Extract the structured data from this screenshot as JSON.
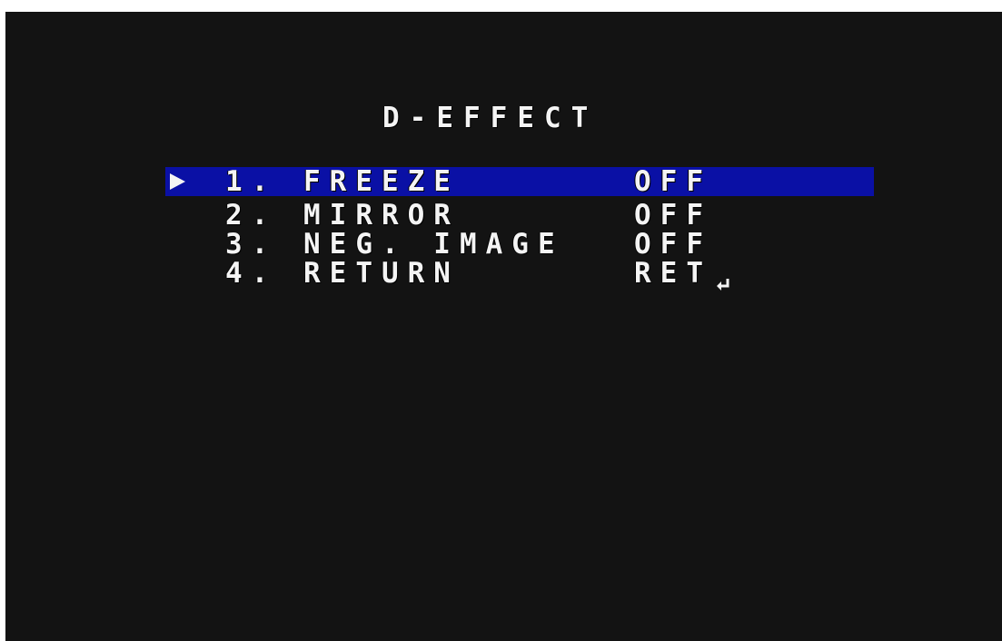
{
  "menu": {
    "title": "D-EFFECT",
    "items": [
      {
        "label": "1. FREEZE",
        "value": "OFF"
      },
      {
        "label": "2. MIRROR",
        "value": "OFF"
      },
      {
        "label": "3. NEG. IMAGE",
        "value": "OFF"
      },
      {
        "label": "4. RETURN",
        "value": "RET"
      }
    ]
  },
  "icons": {
    "cursor": "play-triangle-icon",
    "return": "return-arrow-icon"
  },
  "colors": {
    "background": "#131313",
    "highlight": "#0a10a5",
    "text": "#f4f4f4"
  }
}
